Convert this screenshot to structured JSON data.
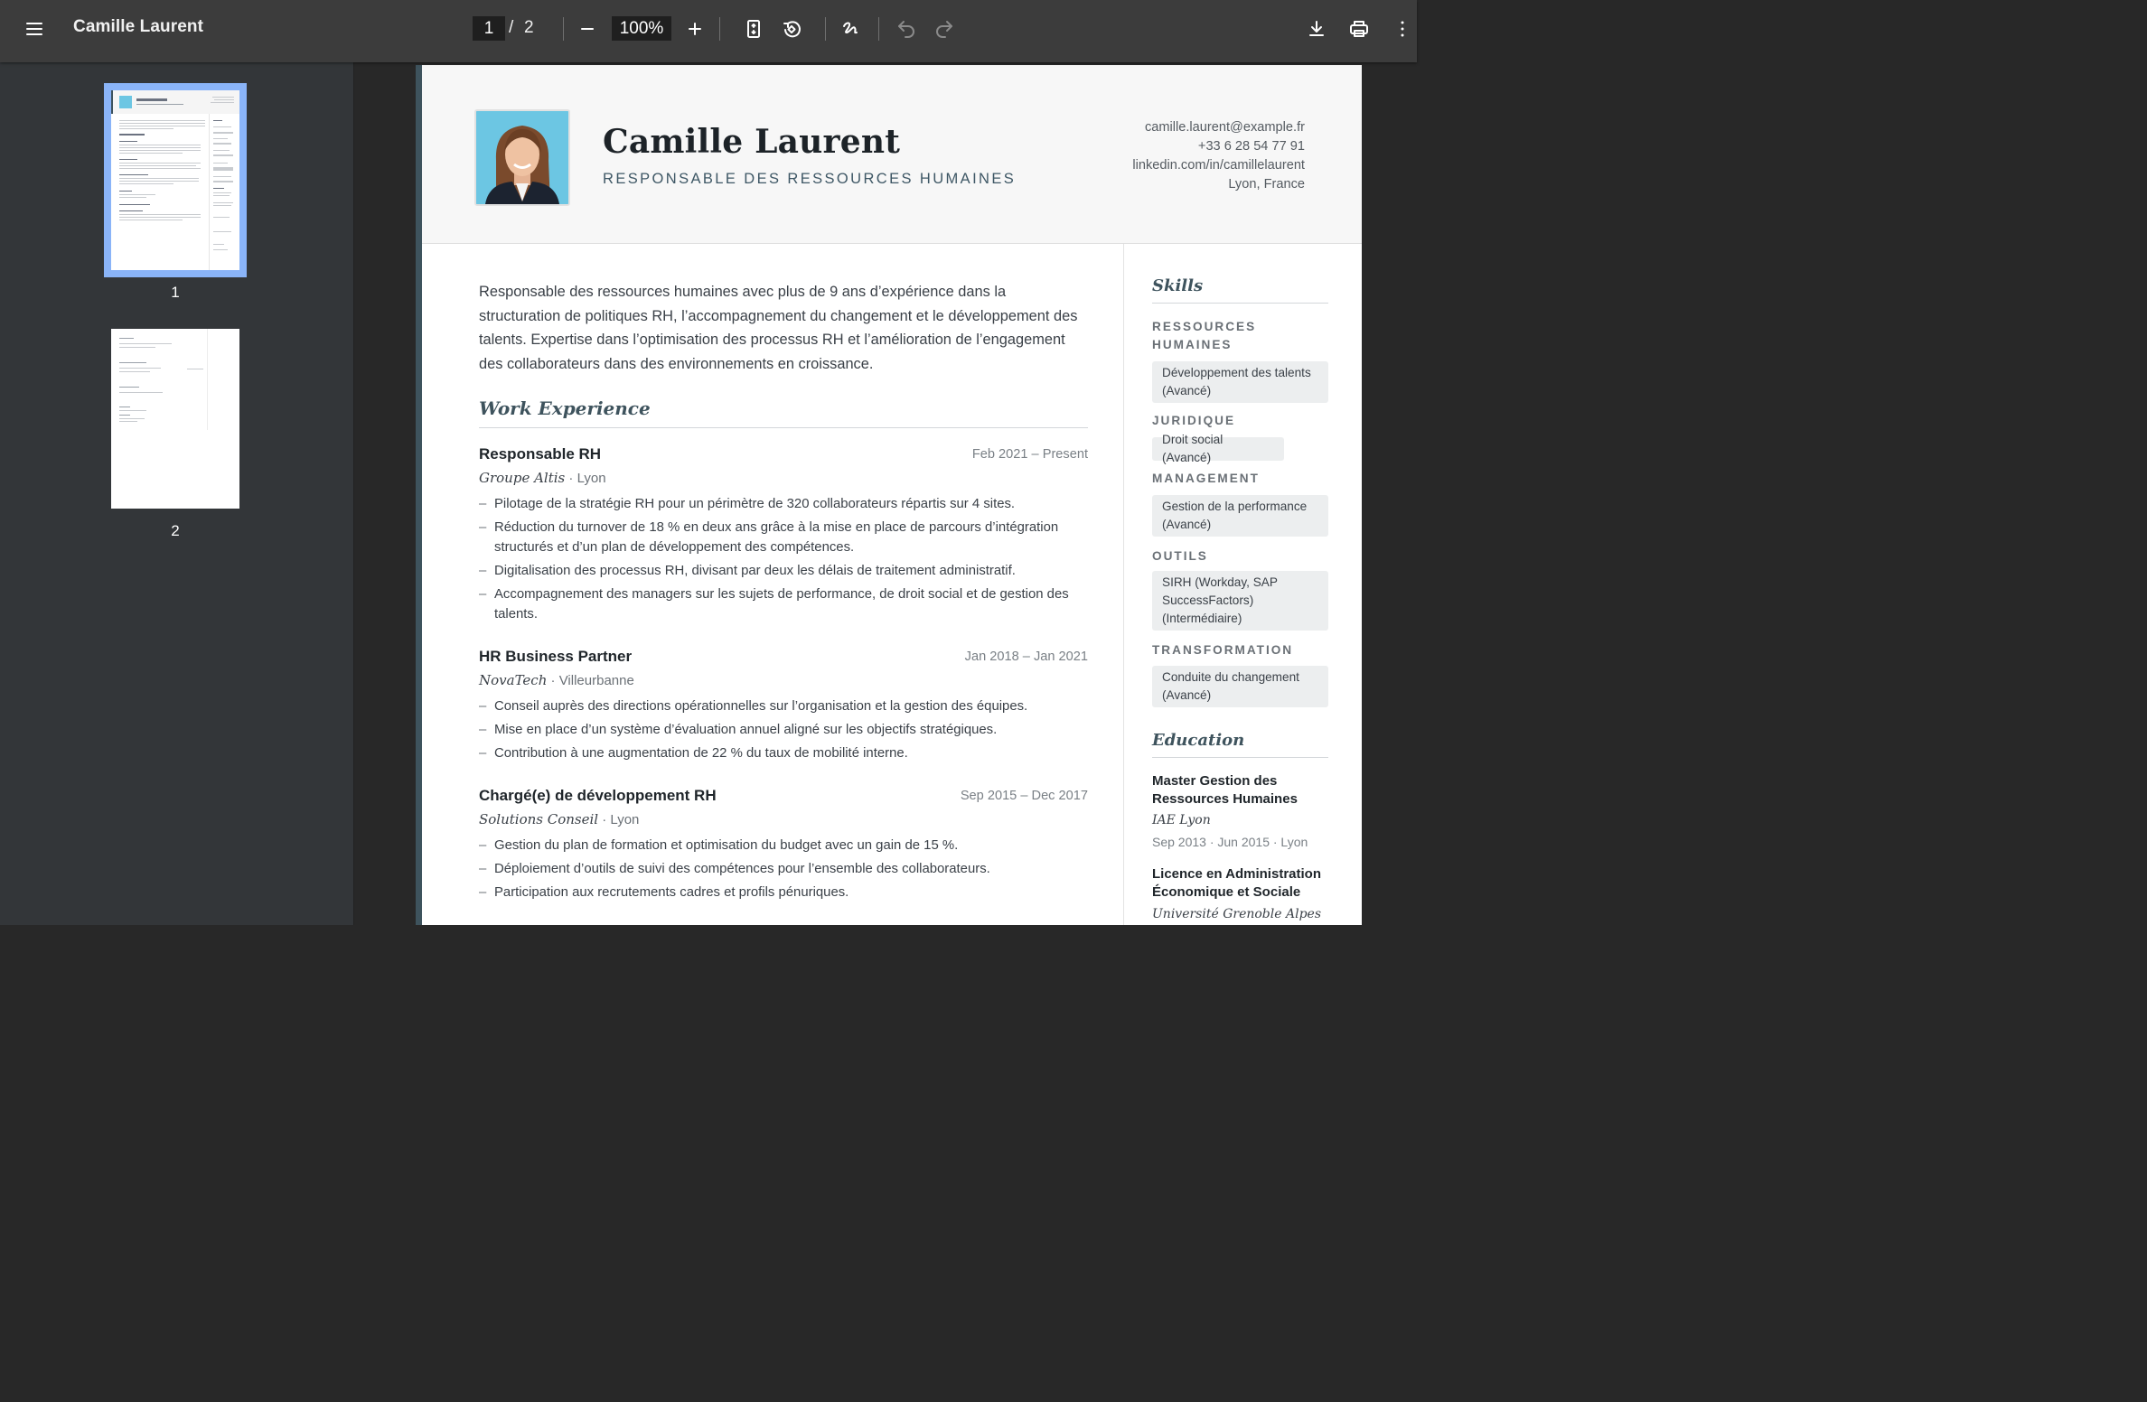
{
  "toolbar": {
    "doc_title": "Camille Laurent",
    "current_page": "1",
    "separator": "/",
    "total_pages": "2",
    "zoom": "100%"
  },
  "thumbnails": [
    {
      "label": "1"
    },
    {
      "label": "2"
    }
  ],
  "resume": {
    "name": "Camille Laurent",
    "role": "RESPONSABLE DES RESSOURCES HUMAINES",
    "contact": {
      "email": "camille.laurent@example.fr",
      "phone": "+33 6 28 54 77 91",
      "linkedin": "linkedin.com/in/camillelaurent",
      "location": "Lyon, France"
    },
    "summary": "Responsable des ressources humaines avec plus de 9 ans d’expérience dans la structuration de politiques RH, l’accompagnement du changement et le développement des talents. Expertise dans l’optimisation des processus RH et l’amélioration de l’engagement des collaborateurs dans des environnements en croissance.",
    "work_title": "Work Experience",
    "jobs": [
      {
        "title": "Responsable RH",
        "dates": "Feb 2021 – Present",
        "company": "Groupe Altis",
        "location": "· Lyon",
        "bullets": [
          "Pilotage de la stratégie RH pour un périmètre de 320 collaborateurs répartis sur 4 sites.",
          "Réduction du turnover de 18 % en deux ans grâce à la mise en place de parcours d’intégration structurés et d’un plan de développement des compétences.",
          "Digitalisation des processus RH, divisant par deux les délais de traitement administratif.",
          "Accompagnement des managers sur les sujets de performance, de droit social et de gestion des talents."
        ]
      },
      {
        "title": "HR Business Partner",
        "dates": "Jan 2018 – Jan 2021",
        "company": "NovaTech",
        "location": "· Villeurbanne",
        "bullets": [
          "Conseil auprès des directions opérationnelles sur l’organisation et la gestion des équipes.",
          "Mise en place d’un système d’évaluation annuel aligné sur les objectifs stratégiques.",
          "Contribution à une augmentation de 22 % du taux de mobilité interne."
        ]
      },
      {
        "title": "Chargé(e) de développement RH",
        "dates": "Sep 2015 – Dec 2017",
        "company": "Solutions Conseil",
        "location": "· Lyon",
        "bullets": [
          "Gestion du plan de formation et optimisation du budget avec un gain de 15 %.",
          "Déploiement d’outils de suivi des compétences pour l’ensemble des collaborateurs.",
          "Participation aux recrutements cadres et profils pénuriques."
        ]
      }
    ],
    "skills_title": "Skills",
    "skills": [
      {
        "category_line1": "RESSOURCES",
        "category_line2": "HUMAINES",
        "tag_line1": "Développement des talents",
        "tag_line2": "(Avancé)"
      },
      {
        "category_line1": "JURIDIQUE",
        "tag_line1": "Droit social (Avancé)"
      },
      {
        "category_line1": "MANAGEMENT",
        "tag_line1": "Gestion de la performance",
        "tag_line2": "(Avancé)"
      },
      {
        "category_line1": "OUTILS",
        "tag_line1": "SIRH (Workday, SAP",
        "tag_line2": "SuccessFactors)",
        "tag_line3": "(Intermédiaire)"
      },
      {
        "category_line1": "TRANSFORMATION",
        "tag_line1": "Conduite du changement",
        "tag_line2": "(Avancé)"
      }
    ],
    "education_title": "Education",
    "education": [
      {
        "degree_line1": "Master Gestion des",
        "degree_line2": "Ressources Humaines",
        "school": "IAE Lyon",
        "dates": "Sep 2013 · Jun 2015 · Lyon"
      },
      {
        "degree_line1": "Licence en Administration",
        "degree_line2": "Économique et Sociale",
        "school": "Université Grenoble Alpes"
      }
    ]
  },
  "colors": {
    "toolbar_bg": "#3c3c3c",
    "sidebar_bg": "#333639",
    "viewer_bg": "#282828",
    "accent": "#3e535d",
    "thumb_selected": "#8ab4f8"
  },
  "icons": [
    "menu-icon",
    "zoom-out-icon",
    "zoom-in-icon",
    "fit-page-icon",
    "rotate-icon",
    "annotate-icon",
    "undo-icon",
    "redo-icon",
    "download-icon",
    "print-icon",
    "more-vert-icon"
  ]
}
